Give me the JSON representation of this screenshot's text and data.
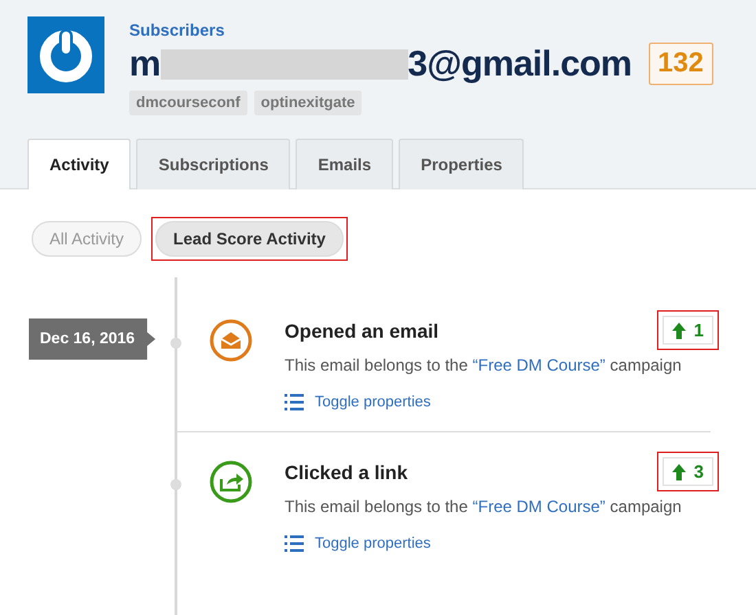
{
  "breadcrumb": "Subscribers",
  "email": {
    "start": "m",
    "end": "3@gmail.com",
    "redacted": true
  },
  "score": "132",
  "tags": [
    "dmcourseconf",
    "optinexitgate"
  ],
  "tabs": [
    {
      "label": "Activity",
      "selected": true
    },
    {
      "label": "Subscriptions",
      "selected": false
    },
    {
      "label": "Emails",
      "selected": false
    },
    {
      "label": "Properties",
      "selected": false
    }
  ],
  "filters": [
    {
      "label": "All Activity",
      "selected": false,
      "highlighted": false
    },
    {
      "label": "Lead Score Activity",
      "selected": true,
      "highlighted": true
    }
  ],
  "date": "Dec 16, 2016",
  "events": [
    {
      "kind": "open",
      "title": "Opened an email",
      "score": "1",
      "highlighted": true,
      "description_before": "This email belongs to the ",
      "campaign": "“Free DM Course”",
      "description_after": " campaign",
      "toggle": "Toggle properties"
    },
    {
      "kind": "click",
      "title": "Clicked a link",
      "score": "3",
      "highlighted": true,
      "description_before": "This email belongs to the ",
      "campaign": "“Free DM Course”",
      "description_after": " campaign",
      "toggle": "Toggle properties"
    }
  ]
}
